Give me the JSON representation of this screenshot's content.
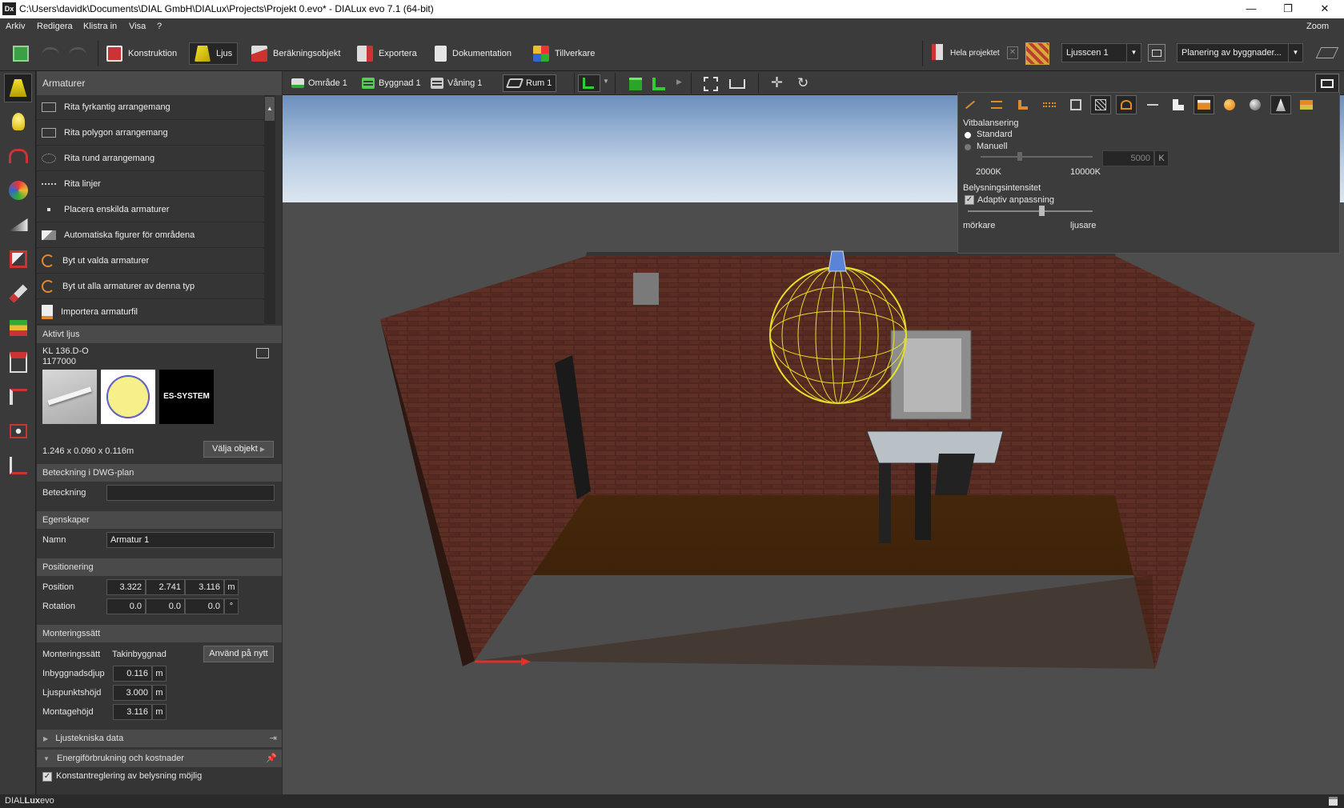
{
  "window": {
    "title": "C:\\Users\\davidk\\Documents\\DIAL GmbH\\DIALux\\Projects\\Projekt 0.evo* - DIALux evo 7.1  (64-bit)",
    "app_icon": "Dx",
    "minimize": "—",
    "restore": "❐",
    "close": "✕"
  },
  "menu": [
    "Arkiv",
    "Redigera",
    "Klistra in",
    "Visa",
    "?"
  ],
  "menu_right": "Zoom",
  "ribbon": {
    "tabs": [
      "Konstruktion",
      "Ljus",
      "Beräkningsobjekt",
      "Exportera",
      "Dokumentation",
      "Tillverkare"
    ],
    "active_tab": "Ljus",
    "hela_projektet": "Hela projektet",
    "light_scene": "Ljusscen 1",
    "planning": "Planering av byggnader..."
  },
  "panel": {
    "armaturer_title": "Armaturer",
    "armaturer_items": [
      "Rita fyrkantig arrangemang",
      "Rita polygon arrangemang",
      "Rita rund arrangemang",
      "Rita linjer",
      "Placera enskilda armaturer",
      "Automatiska figurer för områdena",
      "Byt ut valda armaturer",
      "Byt ut alla armaturer av denna typ",
      "Importera armaturfil"
    ],
    "aktivt_ljus": {
      "title": "Aktivt ljus",
      "name": "KL 136.D-O",
      "number": "1177000",
      "brand": "ES-SYSTEM",
      "dims": "1.246 x 0.090 x 0.116m",
      "select_button": "Välja objekt"
    },
    "beteckning": {
      "title": "Beteckning i DWG-plan",
      "label": "Beteckning",
      "value": ""
    },
    "egenskaper": {
      "title": "Egenskaper",
      "label": "Namn",
      "value": "Armatur 1"
    },
    "positionering": {
      "title": "Positionering",
      "position_label": "Position",
      "position": [
        "3.322",
        "2.741",
        "3.116"
      ],
      "position_unit": "m",
      "rotation_label": "Rotation",
      "rotation": [
        "0.0",
        "0.0",
        "0.0"
      ],
      "rotation_unit": "°"
    },
    "montering": {
      "title": "Monteringssätt",
      "type_label": "Monteringssätt",
      "type_value": "Takinbyggnad",
      "reapply_button": "Använd på nytt",
      "fields": [
        {
          "label": "Inbyggnadsdjup",
          "value": "0.116",
          "unit": "m"
        },
        {
          "label": "Ljuspunktshöjd",
          "value": "3.000",
          "unit": "m"
        },
        {
          "label": "Montagehöjd",
          "value": "3.116",
          "unit": "m"
        }
      ]
    },
    "ljustekniska": "Ljustekniska data",
    "energi": "Energiförbrukning och kostnader",
    "konstant": "Konstantreglering av belysning möjlig"
  },
  "viewport": {
    "breadcrumbs": [
      "Område 1",
      "Byggnad 1",
      "Våning 1",
      "Rum 1"
    ],
    "active_breadcrumb": "Rum 1"
  },
  "overlay": {
    "white_balance_title": "Vitbalansering",
    "standard": "Standard",
    "manual": "Manuell",
    "kelvin_value": "5000",
    "kelvin_unit": "K",
    "min_label": "2000K",
    "max_label": "10000K",
    "intensity_title": "Belysningsintensitet",
    "adaptive": "Adaptiv anpassning",
    "darker": "mörkare",
    "brighter": "ljusare"
  },
  "statusbar": {
    "brand_a": "DIAL",
    "brand_b": "Lux",
    "brand_c": "evo"
  }
}
